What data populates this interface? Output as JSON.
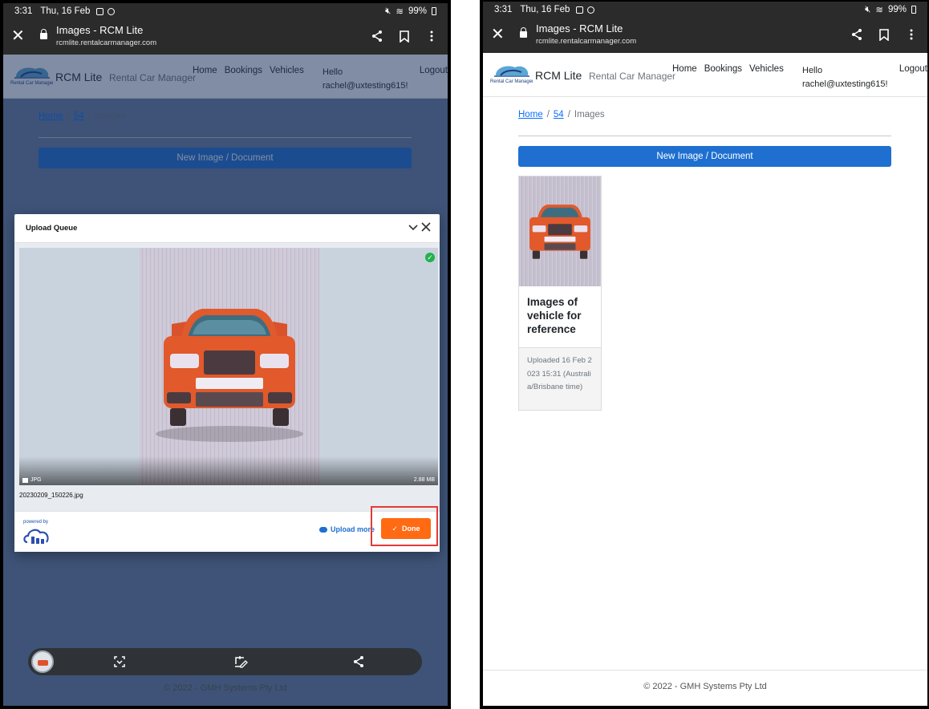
{
  "status": {
    "time": "3:31",
    "date": "Thu, 16 Feb",
    "battery": "99%"
  },
  "browser": {
    "title": "Images - RCM Lite",
    "url": "rcmlite.rentalcarmanager.com",
    "close_icon": "close-icon",
    "share_icon": "share-icon",
    "bookmark_icon": "bookmark-icon",
    "menu_icon": "more-vert-icon"
  },
  "site": {
    "logo_text": "Rental Car Manager",
    "brand": "RCM Lite",
    "brand_sub": "Rental Car Manager",
    "nav": [
      "Home",
      "Bookings",
      "Vehicles"
    ],
    "hello_line1": "Hello",
    "hello_line2": "rachel@uxtesting615!",
    "logout": "Logout"
  },
  "breadcrumb": {
    "home": "Home",
    "id": "54",
    "current": "Images",
    "sep": "/"
  },
  "new_button": "New Image / Document",
  "upload_queue": {
    "title": "Upload Queue",
    "file_type": "JPG",
    "file_size": "2.88 MB",
    "file_name": "20230209_150226.jpg",
    "powered_by": "powered by",
    "upload_more": "Upload more",
    "done": "Done"
  },
  "gallery": {
    "card_title": "Images of vehicle for reference",
    "card_meta": "Uploaded 16 Feb 2023 15:31 (Australia/Brisbane time)"
  },
  "footer": "© 2022 - GMH Systems Pty Ltd",
  "colors": {
    "primary": "#1e6fd0",
    "done": "#ff6a13",
    "highlight": "#e53935",
    "success": "#22b14c"
  }
}
